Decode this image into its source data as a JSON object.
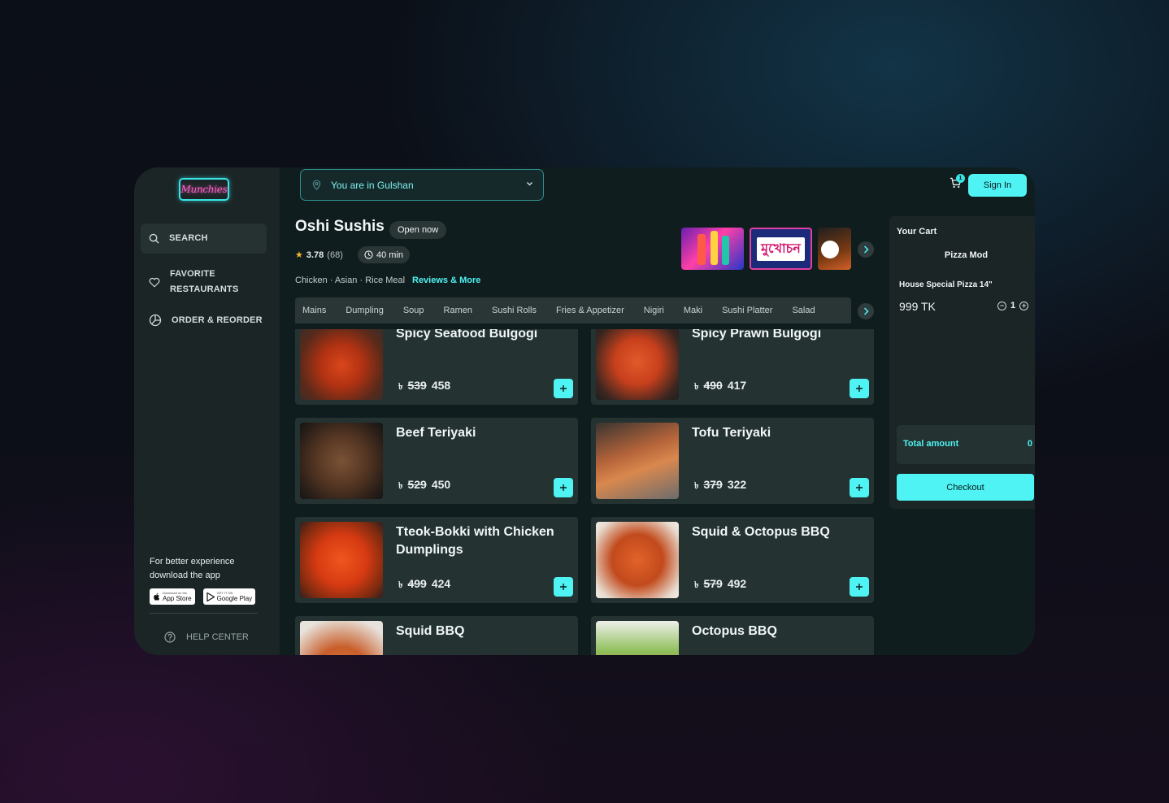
{
  "brand": {
    "logo_text": "Munchies"
  },
  "sidebar": {
    "items": [
      {
        "label": "SEARCH",
        "icon": "search-icon"
      },
      {
        "label": "FAVORITE\nRESTAURANTS",
        "line1": "FAVORITE",
        "line2": "RESTAURANTS",
        "icon": "heart-icon"
      },
      {
        "label": "ORDER & REORDER",
        "icon": "pie-chart-icon"
      }
    ],
    "promo_line1": "For better experience",
    "promo_line2": "download the app",
    "app_store": {
      "small": "Download on the",
      "big": "App Store"
    },
    "google_play": {
      "small": "GET IT ON",
      "big": "Google Play"
    },
    "help_center": "HELP CENTER"
  },
  "header": {
    "location_text": "You are in Gulshan",
    "cart_count": "1",
    "sign_in": "Sign In"
  },
  "restaurant": {
    "name": "Oshi Sushis",
    "status": "Open now",
    "rating": "3.78",
    "rating_count": "(68)",
    "delivery_time": "40 min",
    "cuisines": "Chicken · Asian · Rice Meal",
    "reviews_link": "Reviews & More",
    "featured_thumb_text": "মুখোচন"
  },
  "categories": [
    "Mains",
    "Dumpling",
    "Soup",
    "Ramen",
    "Sushi Rolls",
    "Fries & Appetizer",
    "Nigiri",
    "Maki",
    "Sushi Platter",
    "Salad"
  ],
  "currency_symbol": "৳",
  "menu": [
    {
      "name": "Spicy Seafood Bulgogi",
      "old_price": "539",
      "price": "458"
    },
    {
      "name": "Spicy Prawn Bulgogi",
      "old_price": "490",
      "price": "417"
    },
    {
      "name": "Beef Teriyaki",
      "old_price": "529",
      "price": "450"
    },
    {
      "name": "Tofu Teriyaki",
      "old_price": "379",
      "price": "322"
    },
    {
      "name": "Tteok-Bokki with Chicken Dumplings",
      "old_price": "499",
      "price": "424"
    },
    {
      "name": "Squid & Octopus BBQ",
      "old_price": "579",
      "price": "492"
    },
    {
      "name": "Squid BBQ",
      "old_price": "",
      "price": ""
    },
    {
      "name": "Octopus BBQ",
      "old_price": "",
      "price": ""
    }
  ],
  "cart": {
    "title": "Your Cart",
    "restaurant": "Pizza Mod",
    "item_name": "House Special Pizza 14\"",
    "item_price": "999 TK",
    "quantity": "1",
    "total_label": "Total amount",
    "total_value": "0",
    "checkout": "Checkout"
  },
  "colors": {
    "accent": "#4ff3f3",
    "panel": "#1b2526",
    "card": "#243232",
    "logo_pink": "#ff5fc8"
  }
}
